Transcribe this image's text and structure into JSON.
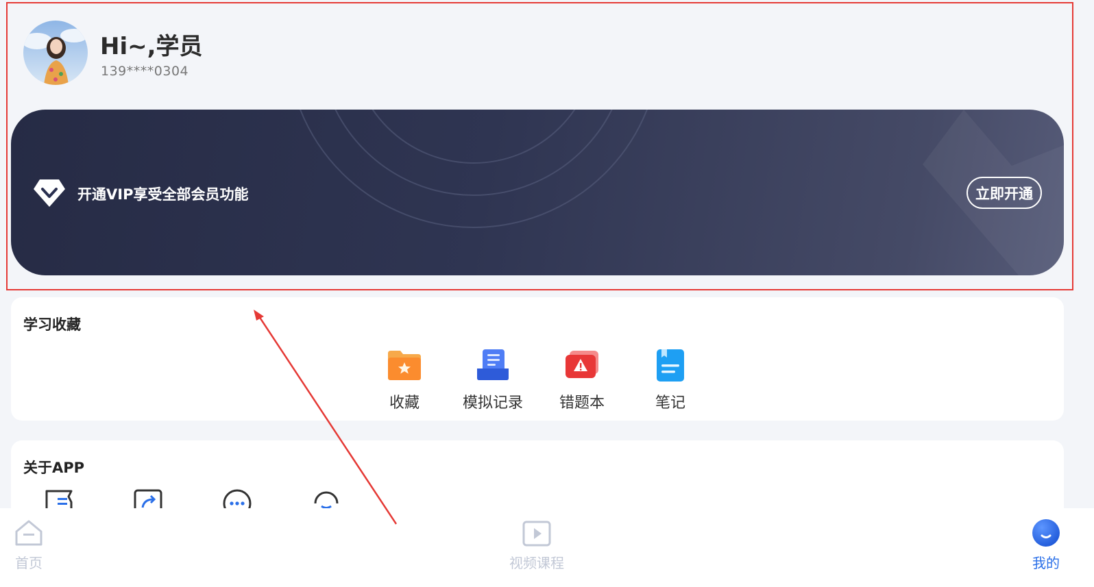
{
  "user": {
    "greeting": "Hi~,学员",
    "phone": "139****0304"
  },
  "vip": {
    "text": "开通VIP享受全部会员功能",
    "button": "立即开通"
  },
  "study": {
    "title": "学习收藏",
    "items": [
      {
        "label": "收藏",
        "icon": "star-folder-icon",
        "color": "#f79a3b"
      },
      {
        "label": "模拟记录",
        "icon": "document-record-icon",
        "color": "#3d6cf0"
      },
      {
        "label": "错题本",
        "icon": "warning-book-icon",
        "color": "#ee3b3b"
      },
      {
        "label": "笔记",
        "icon": "notebook-icon",
        "color": "#1aa3f2"
      }
    ]
  },
  "about": {
    "title": "关于APP",
    "icons": [
      "list-icon",
      "share-icon",
      "chat-icon",
      "refresh-icon"
    ]
  },
  "tabs": [
    {
      "label": "首页",
      "icon": "home-icon",
      "active": false
    },
    {
      "label": "视频课程",
      "icon": "video-play-icon",
      "active": false
    },
    {
      "label": "我的",
      "icon": "profile-icon",
      "active": true
    }
  ],
  "colors": {
    "accent": "#2a6fe8",
    "tab_inactive": "#c2c8d6",
    "annotation": "#e53935"
  }
}
